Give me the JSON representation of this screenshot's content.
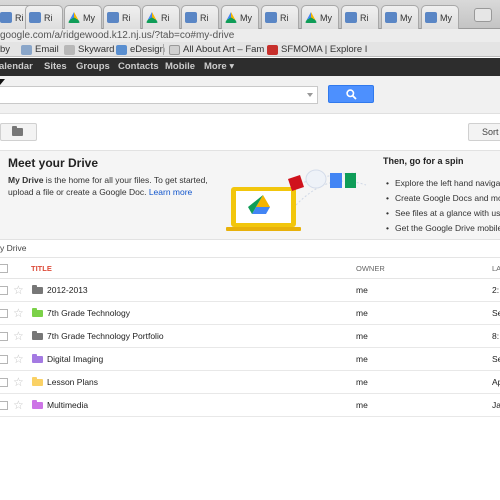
{
  "browser": {
    "tabs": [
      {
        "label": "Ri",
        "icon": "school-icon"
      },
      {
        "label": "Ri",
        "icon": "school-icon"
      },
      {
        "label": "My",
        "icon": "drive-icon"
      },
      {
        "label": "Ri",
        "icon": "school-icon"
      },
      {
        "label": "Ri",
        "icon": "drive-icon"
      },
      {
        "label": "Ri",
        "icon": "school-icon"
      },
      {
        "label": "My",
        "icon": "drive-icon"
      },
      {
        "label": "Ri",
        "icon": "school-icon"
      },
      {
        "label": "My",
        "icon": "drive-icon"
      },
      {
        "label": "Ri",
        "icon": "school-icon"
      },
      {
        "label": "My",
        "icon": "school-icon"
      },
      {
        "label": "My",
        "icon": "school-icon"
      }
    ],
    "url": "google.com/a/ridgewood.k12.nj.us/?tab=co#my-drive",
    "bookmarks": [
      {
        "label": "by",
        "icon": ""
      },
      {
        "label": "Email",
        "icon": "email-icon"
      },
      {
        "label": "Skyward",
        "icon": "skyward-icon"
      },
      {
        "label": "eDesign",
        "icon": "edesign-icon"
      },
      {
        "label": "All About Art – Fam",
        "icon": "page-icon"
      },
      {
        "label": "SFMOMA | Explore I",
        "icon": "sfmoma-icon"
      }
    ]
  },
  "gbar": {
    "items": [
      "alendar",
      "Sites",
      "Groups",
      "Contacts",
      "Mobile",
      "More ▾"
    ]
  },
  "search": {
    "placeholder": ""
  },
  "toolbar": {
    "sort_label": "Sort"
  },
  "welcome": {
    "title": "Meet your Drive",
    "text_bold": "My Drive",
    "text_rest": " is the home for all your files. To get started, upload a file or create a Google Doc. ",
    "learn_more": "Learn more",
    "spin_title": "Then, go for a spin",
    "tips": [
      "Explore the left hand naviga",
      "Create Google Docs and mo",
      "See files at a glance with us",
      "Get the Google Drive mobile"
    ]
  },
  "list": {
    "breadcrumb": "y Drive",
    "headers": {
      "title": "TITLE",
      "owner": "OWNER",
      "modified": "LA"
    },
    "rows": [
      {
        "name": "2012-2013",
        "owner": "me",
        "modified": "2:",
        "color": "#777777"
      },
      {
        "name": "7th Grade Technology",
        "owner": "me",
        "modified": "Se",
        "color": "#7bd148"
      },
      {
        "name": "7th Grade Technology Portfolio",
        "owner": "me",
        "modified": "8:",
        "color": "#777777"
      },
      {
        "name": "Digital Imaging",
        "owner": "me",
        "modified": "Se",
        "color": "#a47ae2"
      },
      {
        "name": "Lesson Plans",
        "owner": "me",
        "modified": "Ap",
        "color": "#fad165"
      },
      {
        "name": "Multimedia",
        "owner": "me",
        "modified": "Ja",
        "color": "#cd74e6"
      }
    ]
  },
  "colors": {
    "search_button": "#4d90fe",
    "title_header": "#dd4b39",
    "link": "#1155cc",
    "gbar": "#2d2d2d"
  }
}
